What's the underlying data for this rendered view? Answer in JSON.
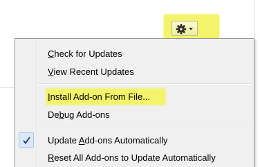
{
  "toolbar": {
    "tools_menu_icon": "gear-icon",
    "dropdown_icon": "chevron-down-icon",
    "highlight_color": "#f3f46a"
  },
  "menu": {
    "items": [
      {
        "pre": "",
        "u": "C",
        "post": "heck for Updates"
      },
      {
        "pre": "",
        "u": "V",
        "post": "iew Recent Updates"
      },
      {
        "pre": "",
        "u": "I",
        "post": "nstall Add-on From File..."
      },
      {
        "pre": "De",
        "u": "b",
        "post": "ug Add-ons"
      },
      {
        "pre": "Update ",
        "u": "A",
        "post": "dd-ons Automatically",
        "checked": true
      },
      {
        "pre": "",
        "u": "R",
        "post": "eset All Add-ons to Update Automatically"
      }
    ],
    "check_icon": "checkmark-icon"
  }
}
